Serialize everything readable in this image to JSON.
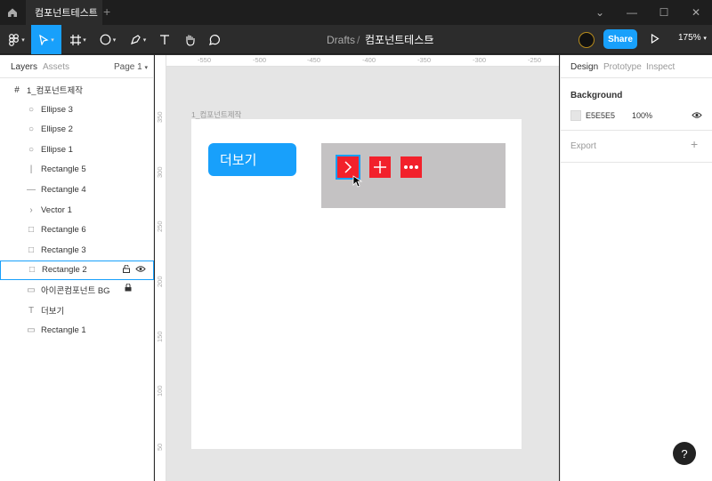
{
  "titlebar": {
    "tab_title": "컴포넌트테스트",
    "tab_close": "×",
    "tab_add": "+",
    "min": "⌄",
    "minimize": "—",
    "maximize": "☐",
    "close": "✕"
  },
  "toolbar": {
    "breadcrumb_root": "Drafts",
    "breadcrumb_sep": "/",
    "file_name": "컴포넌트테스트",
    "share_label": "Share",
    "zoom_label": "175%"
  },
  "left_panel": {
    "tab_layers": "Layers",
    "tab_assets": "Assets",
    "page_label": "Page 1",
    "frame_name": "1_컴포넌트제작",
    "layers": [
      {
        "icon": "○",
        "name": "Ellipse 3"
      },
      {
        "icon": "○",
        "name": "Ellipse 2"
      },
      {
        "icon": "○",
        "name": "Ellipse 1"
      },
      {
        "icon": "|",
        "name": "Rectangle 5"
      },
      {
        "icon": "—",
        "name": "Rectangle 4"
      },
      {
        "icon": "›",
        "name": "Vector 1"
      },
      {
        "icon": "□",
        "name": "Rectangle 6"
      },
      {
        "icon": "□",
        "name": "Rectangle 3"
      },
      {
        "icon": "□",
        "name": "Rectangle 2"
      },
      {
        "icon": "▭",
        "name": "아이콘컴포넌트 BG"
      },
      {
        "icon": "T",
        "name": "더보기"
      },
      {
        "icon": "▭",
        "name": "Rectangle 1"
      }
    ]
  },
  "canvas": {
    "ruler_top": [
      "-550",
      "-500",
      "-450",
      "-400",
      "-350",
      "-300",
      "-250"
    ],
    "ruler_left": [
      "350",
      "300",
      "250",
      "200",
      "150",
      "100",
      "50"
    ],
    "frame_label": "1_컴포넌트제작",
    "more_button_text": "더보기"
  },
  "right_panel": {
    "tab_design": "Design",
    "tab_prototype": "Prototype",
    "tab_inspect": "Inspect",
    "background_title": "Background",
    "bg_hex": "E5E5E5",
    "bg_opacity": "100%",
    "export_title": "Export",
    "export_add": "+"
  },
  "help_label": "?",
  "colors": {
    "accent": "#18a0fb",
    "red_icon": "#f2212b",
    "icon_bg": "#c4c2c3",
    "canvas_bg": "#e5e5e5"
  }
}
